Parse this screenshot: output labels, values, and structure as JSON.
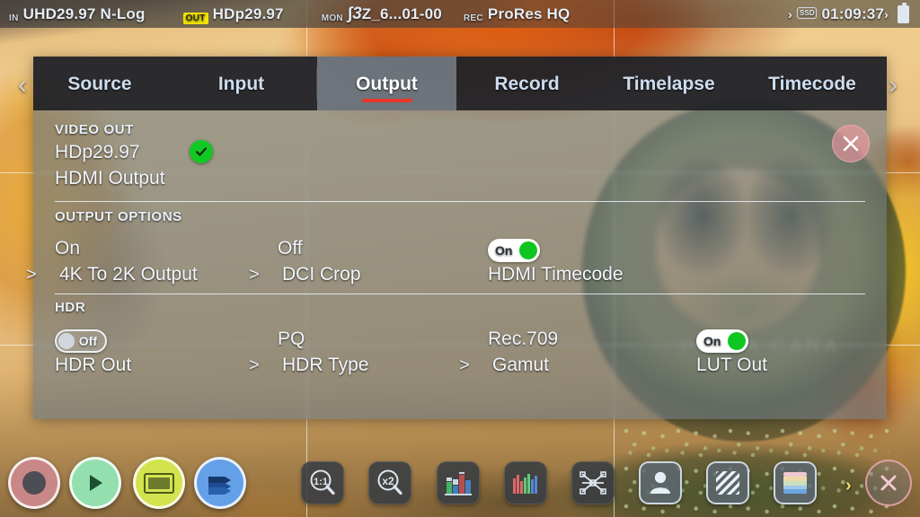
{
  "statusbar": {
    "input": {
      "tag": "IN",
      "value": "UHD29.97 N-Log"
    },
    "output": {
      "tag": "OUT",
      "value": "HDp29.97"
    },
    "monitor": {
      "tag": "MON",
      "lut_icon": "∫3",
      "value": "Z_6...01-00"
    },
    "record": {
      "tag": "REC",
      "value": "ProRes HQ"
    },
    "media": {
      "chevron_left": "›",
      "drive_label": "SSD",
      "time_remaining": "01:09:37",
      "chevron_right": "›"
    },
    "battery_icon": "battery-icon"
  },
  "panel": {
    "nav_left_icon": "‹",
    "nav_right_icon": "›",
    "close_icon": "close-icon",
    "tabs": [
      {
        "label": "Source",
        "active": false
      },
      {
        "label": "Input",
        "active": false
      },
      {
        "label": "Output",
        "active": true
      },
      {
        "label": "Record",
        "active": false
      },
      {
        "label": "Timelapse",
        "active": false
      },
      {
        "label": "Timecode",
        "active": false
      }
    ],
    "sections": [
      {
        "title": "VIDEO OUT",
        "items": [
          {
            "value": "HDp29.97",
            "label": "HDMI Output",
            "control": "check",
            "chevron": ""
          }
        ]
      },
      {
        "title": "OUTPUT OPTIONS",
        "items": [
          {
            "value": "On",
            "label": "4K To 2K Output",
            "control": "text",
            "chevron": ">"
          },
          {
            "value": "Off",
            "label": "DCI Crop",
            "control": "text",
            "chevron": ">"
          },
          {
            "value": "On",
            "label": "HDMI Timecode",
            "control": "toggle-on",
            "chevron": ""
          }
        ]
      },
      {
        "title": "HDR",
        "items": [
          {
            "value": "Off",
            "label": "HDR Out",
            "control": "toggle-off",
            "chevron": ""
          },
          {
            "value": "PQ",
            "label": "HDR Type",
            "control": "text",
            "chevron": ">"
          },
          {
            "value": "Rec.709",
            "label": "Gamut",
            "control": "text",
            "chevron": ">"
          },
          {
            "value": "On",
            "label": "LUT Out",
            "control": "toggle-on",
            "chevron": ""
          }
        ]
      }
    ]
  },
  "toolbar": {
    "round_buttons": [
      {
        "icon": "record-icon",
        "color": "#c98787"
      },
      {
        "icon": "play-icon",
        "color": "#93dfae"
      },
      {
        "icon": "monitor-icon",
        "color": "#d3e34e"
      },
      {
        "icon": "library-icon",
        "color": "#64a0e8"
      }
    ],
    "tool_buttons": [
      {
        "icon": "zoom-1to1-icon",
        "label": "1:1"
      },
      {
        "icon": "zoom-2x-icon",
        "label": "x2"
      },
      {
        "icon": "waveform-icon",
        "label": ""
      },
      {
        "icon": "rgb-parade-icon",
        "label": ""
      },
      {
        "icon": "vectorscope-icon",
        "label": ""
      },
      {
        "icon": "skintone-icon",
        "label": ""
      },
      {
        "icon": "zebra-icon",
        "label": ""
      },
      {
        "icon": "false-color-icon",
        "label": ""
      }
    ],
    "next_chevron": "›",
    "exit_icon": "close-icon"
  },
  "background": {
    "coin_text": "PUNTA CANA"
  },
  "colors": {
    "accent_red": "#e8372a",
    "toggle_on_green": "#0ec61f",
    "check_green": "#12c924",
    "status_yellow": "#f3e400",
    "panel_fill": "#687682",
    "tab_bar": "#1e1e24"
  }
}
